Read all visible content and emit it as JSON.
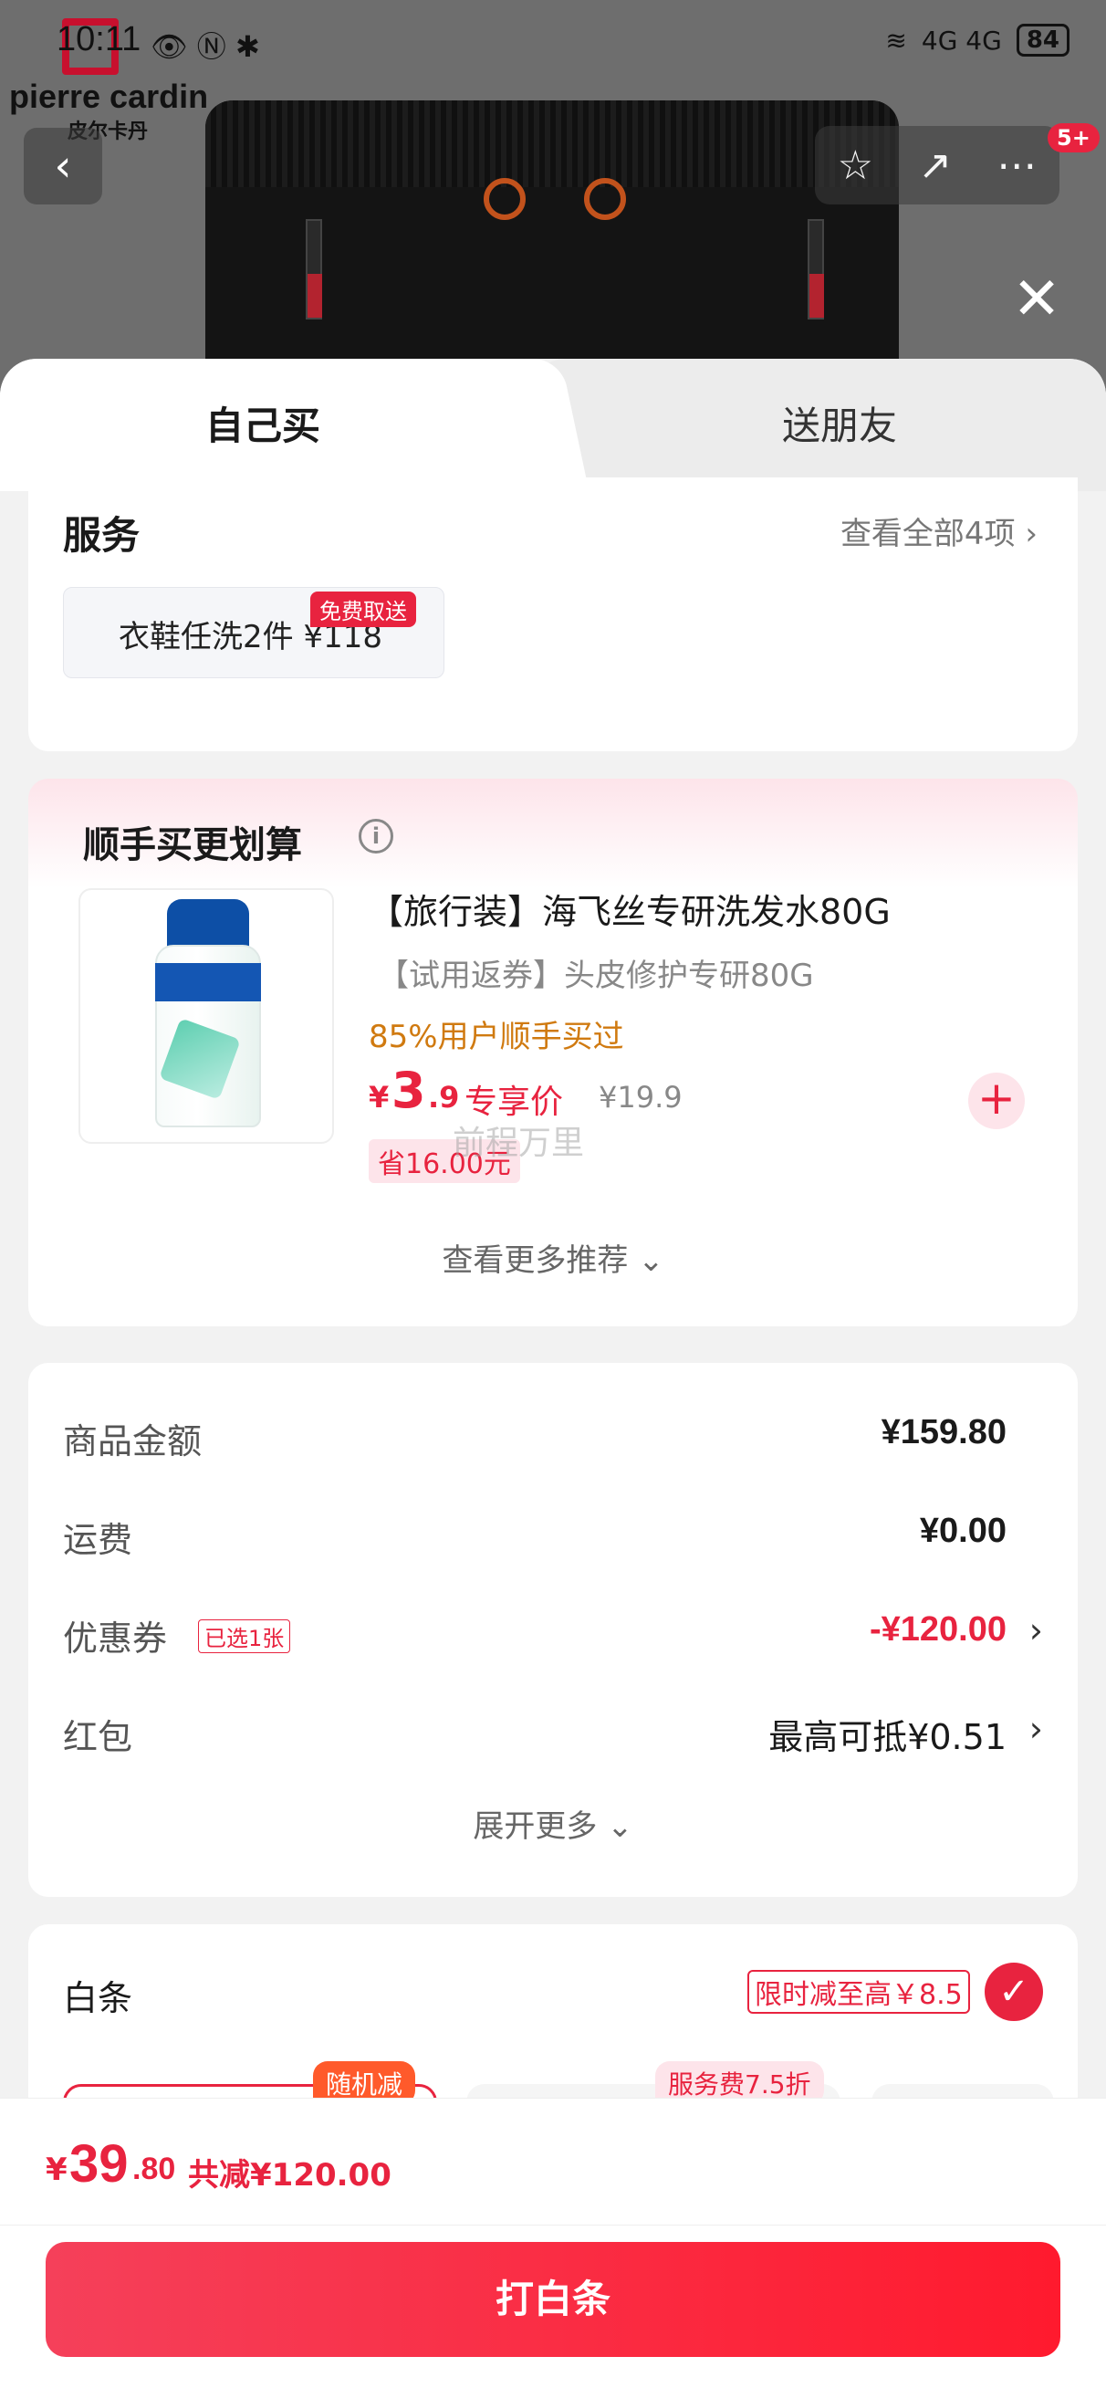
{
  "status_bar": {
    "time": "10:11",
    "left_icons": "👁 Ⓝ ✱",
    "network": "4G 4G",
    "battery": "84"
  },
  "brand": {
    "name": "pierre cardin",
    "name_cn": "皮尔卡丹"
  },
  "header": {
    "back_icon": "‹",
    "actions": [
      "☆",
      "↗",
      "⋯"
    ],
    "badge": "5+",
    "close_icon": "✕"
  },
  "tabs": [
    {
      "label": "自己买",
      "active": true
    },
    {
      "label": "送朋友",
      "active": false
    }
  ],
  "service": {
    "title": "服务",
    "more": "查看全部4项",
    "tile_text": "衣鞋任洗2件  ¥118",
    "tag": "免费取送"
  },
  "upsell": {
    "title": "顺手买更划算",
    "info_icon": "i",
    "product": {
      "name": "【旅行装】海飞丝专研洗发水80G",
      "subtitle": "【试用返券】头皮修护专研80G",
      "stat": "85%用户顺手买过",
      "price_currency": "¥",
      "price_int": "3",
      "price_dec": ".9",
      "price_tag": "专享价",
      "original_price": "¥19.9",
      "save": "省16.00元"
    },
    "watermark": "前程万里",
    "add_icon": "+",
    "see_more": "查看更多推荐 ⌄"
  },
  "summary": {
    "rows": [
      {
        "label": "商品金额",
        "value": "¥159.80"
      },
      {
        "label": "运费",
        "value": "¥0.00"
      },
      {
        "label": "优惠券",
        "tag": "已选1张",
        "value": "-¥120.00"
      },
      {
        "label": "红包",
        "value": "最高可抵¥0.51"
      }
    ],
    "expand": "展开更多 ⌄"
  },
  "baitiao": {
    "title": "白条",
    "promo": "限时减至高￥8.5",
    "check_icon": "✓",
    "plan_tag_1": "随机减",
    "plan_tag_2": "服务费7.5折"
  },
  "footer": {
    "currency": "¥",
    "total_int": "39",
    "total_dec": ".80",
    "saved": "共减¥120.00",
    "pay_label": "打白条"
  }
}
